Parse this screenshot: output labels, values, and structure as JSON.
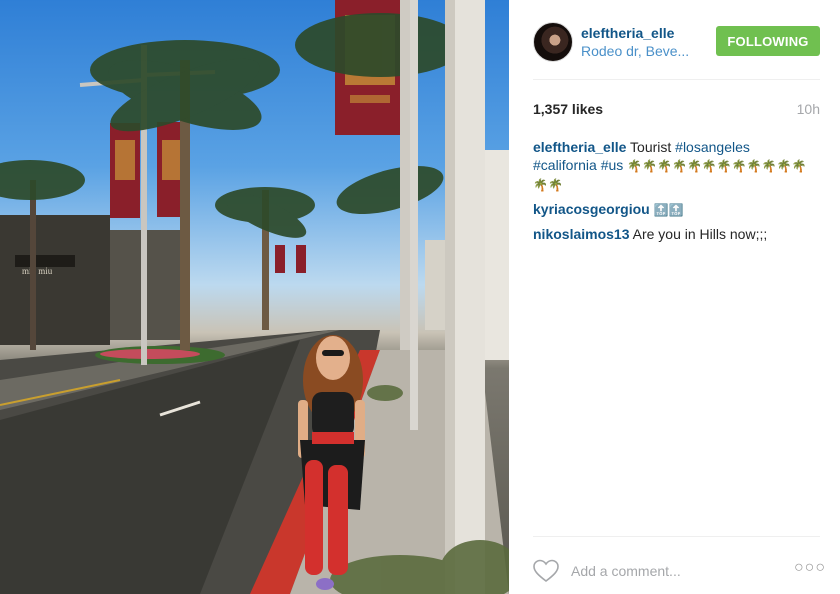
{
  "post": {
    "username": "eleftheria_elle",
    "location": "Rodeo dr, Beve...",
    "follow_label": "FOLLOWING",
    "likes": "1,357 likes",
    "time": "10h",
    "photo_sign_text": "miu miu"
  },
  "caption": {
    "user": "eleftheria_elle",
    "text": "Tourist",
    "tags": [
      "#losangeles",
      "#california",
      "#us"
    ],
    "emojis": "🌴🌴🌴🌴🌴🌴🌴🌴🌴🌴🌴🌴🌴🌴"
  },
  "comments": [
    {
      "user": "kyriacosgeorgiou",
      "text": "🔝🔝"
    },
    {
      "user": "nikoslaimos13",
      "text": "Are you in Hills now;;;"
    }
  ],
  "footer": {
    "comment_placeholder": "Add a comment...",
    "more_label": "○○○"
  },
  "icons": {
    "heart": "heart-icon",
    "more": "more-options-icon"
  },
  "colors": {
    "username": "#125688",
    "follow_button": "#70c050",
    "secondary_text": "#a5a7aa"
  }
}
